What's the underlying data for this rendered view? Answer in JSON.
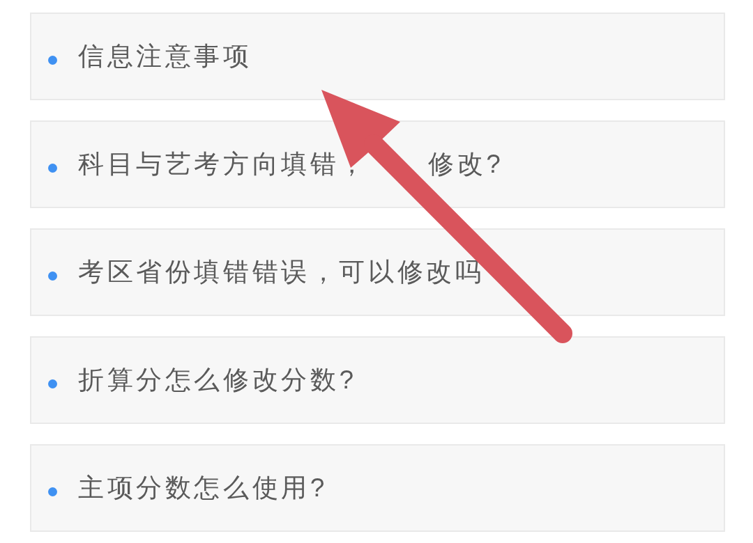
{
  "faq_items": [
    {
      "parts": [
        "信息注意事项"
      ]
    },
    {
      "parts": [
        "科目与艺考方向填错，",
        "修改?"
      ]
    },
    {
      "parts": [
        "考区省份填错错误，可以修改吗"
      ]
    },
    {
      "parts": [
        "折算分怎么修改分数?"
      ]
    },
    {
      "parts": [
        "主项分数怎么使用?"
      ]
    }
  ]
}
